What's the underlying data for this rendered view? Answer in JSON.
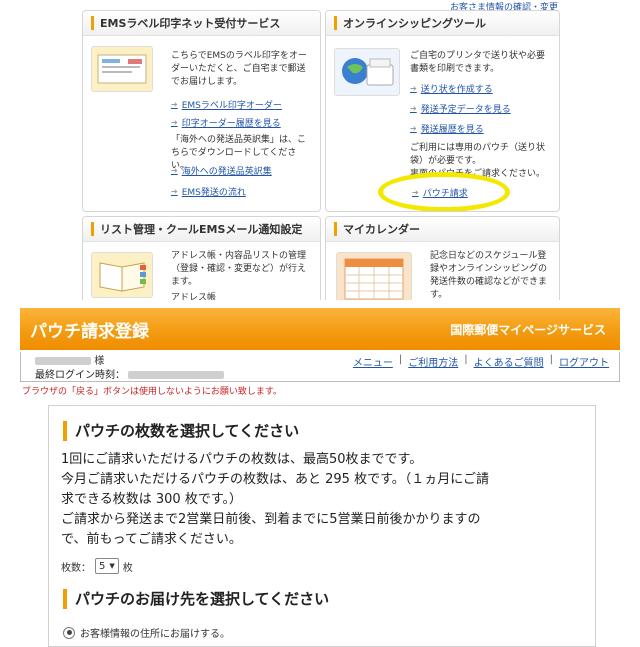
{
  "top": {
    "header_link": "お客さま情報の確認・変更",
    "ems_card": {
      "title": "EMSラベル印字ネット受付サービス",
      "desc": "こちらでEMSのラベル印字をオーダーいただくと、ご自宅まで郵送でお届けします。",
      "links": [
        "EMSラベル印字オーダー",
        "印字オーダー履歴を見る"
      ],
      "note": "「海外への発送品英訳集」は、こちらでダウンロードしてください。",
      "links2": [
        "海外への発送品英訳集",
        "EMS発送の流れ"
      ]
    },
    "shipping_card": {
      "title": "オンラインシッピングツール",
      "desc": "ご自宅のプリンタで送り状や必要書類を印刷できます。",
      "links": [
        "送り状を作成する",
        "発送予定データを見る",
        "発送履歴を見る"
      ],
      "note": "ご利用には専用のパウチ（送り状袋）が必要です。",
      "note2": "裏面のパウチをご請求ください。",
      "pouch_link": "パウチ請求"
    },
    "list_card": {
      "title": "リスト管理・クールEMSメール通知設定",
      "desc": "アドレス帳・内容品リストの管理（登録・確認・変更など）が行えます。",
      "sub": "アドレス帳"
    },
    "calendar_card": {
      "title": "マイカレンダー",
      "desc": "記念日などのスケジュール登録やオンラインシッピングの発送件数の確認などができます。"
    }
  },
  "bottom": {
    "page_title": "パウチ請求登録",
    "service_name": "国際郵便マイページサービス",
    "user_suffix": "様",
    "last_login_label": "最終ログイン時刻：",
    "nav": [
      "メニュー",
      "ご利用方法",
      "よくあるご質問",
      "ログアウト"
    ],
    "warning": "ブラウザの「戻る」ボタンは使用しないようにお願い致します。",
    "section1_title": "パウチの枚数を選択してください",
    "section1_lines": [
      "1回にご請求いただけるパウチの枚数は、最高50枚までです。",
      "今月ご請求いただけるパウチの枚数は、あと 295 枚です。（１ヵ月にご請",
      "求できる枚数は 300 枚です。）",
      "ご請求から発送まで2営業日前後、到着までに5営業日前後かかりますの",
      "で、前もってご請求ください。"
    ],
    "count_label": "枚数：",
    "count_value": "5",
    "count_unit": "枚",
    "section2_title": "パウチのお届け先を選択してください",
    "radio_option": "お客様情報の住所にお届けする。"
  },
  "colors": {
    "accent": "#f39c12",
    "link": "#2255aa",
    "warning": "#cc2222",
    "highlight": "#f5e800"
  }
}
